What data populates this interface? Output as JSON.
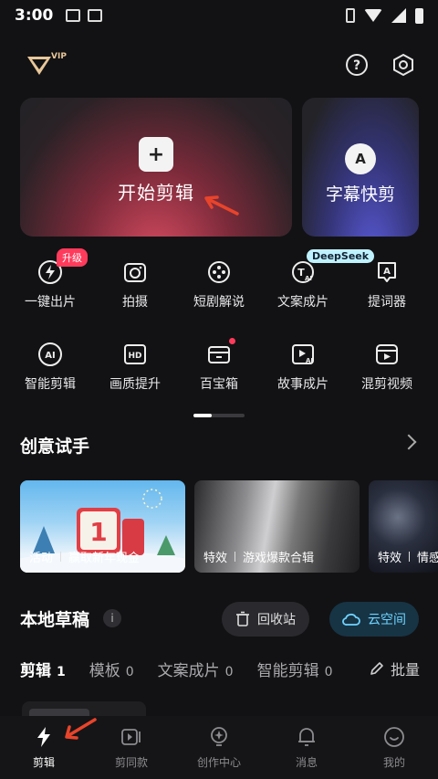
{
  "status_bar": {
    "time": "3:00"
  },
  "header": {
    "vip_badge": "VIP"
  },
  "main_actions": {
    "start_edit_label": "开始剪辑",
    "subtitle_quick_cut_label": "字幕快剪"
  },
  "tools": [
    {
      "label": "一键出片",
      "icon": "lightning-circle-icon"
    },
    {
      "label": "拍摄",
      "icon": "camera-icon"
    },
    {
      "label": "短剧解说",
      "icon": "film-reel-icon"
    },
    {
      "label": "文案成片",
      "icon": "text-ai-icon"
    },
    {
      "label": "提词器",
      "icon": "prompter-icon"
    },
    {
      "label": "智能剪辑",
      "icon": "ai-circle-icon"
    },
    {
      "label": "画质提升",
      "icon": "hd-icon"
    },
    {
      "label": "百宝箱",
      "icon": "toolbox-icon"
    },
    {
      "label": "故事成片",
      "icon": "story-ai-icon"
    },
    {
      "label": "混剪视频",
      "icon": "mix-video-icon"
    }
  ],
  "badges": {
    "upgrade": "升级",
    "deepseek": "DeepSeek"
  },
  "creative": {
    "title": "创意试手",
    "cards": [
      {
        "tag": "活动",
        "title": "赢取新年现金"
      },
      {
        "tag": "特效",
        "title": "游戏爆款合辑"
      },
      {
        "tag": "特效",
        "title": "情感"
      }
    ]
  },
  "drafts": {
    "title": "本地草稿",
    "info_icon": "i",
    "recycle_label": "回收站",
    "cloud_label": "云空间",
    "tabs": [
      {
        "label": "剪辑",
        "count": "1"
      },
      {
        "label": "模板",
        "count": "0"
      },
      {
        "label": "文案成片",
        "count": "0"
      },
      {
        "label": "智能剪辑",
        "count": "0"
      }
    ],
    "batch_label": "批量"
  },
  "nav": [
    {
      "label": "剪辑",
      "icon": "lightning-icon"
    },
    {
      "label": "剪同款",
      "icon": "template-video-icon"
    },
    {
      "label": "创作中心",
      "icon": "creator-bulb-icon"
    },
    {
      "label": "消息",
      "icon": "bell-icon"
    },
    {
      "label": "我的",
      "icon": "smile-face-icon"
    }
  ],
  "colors": {
    "accent_red": "#ff3b5c",
    "cloud_blue": "#6fd3ff",
    "annotation_red": "#e8442b"
  }
}
